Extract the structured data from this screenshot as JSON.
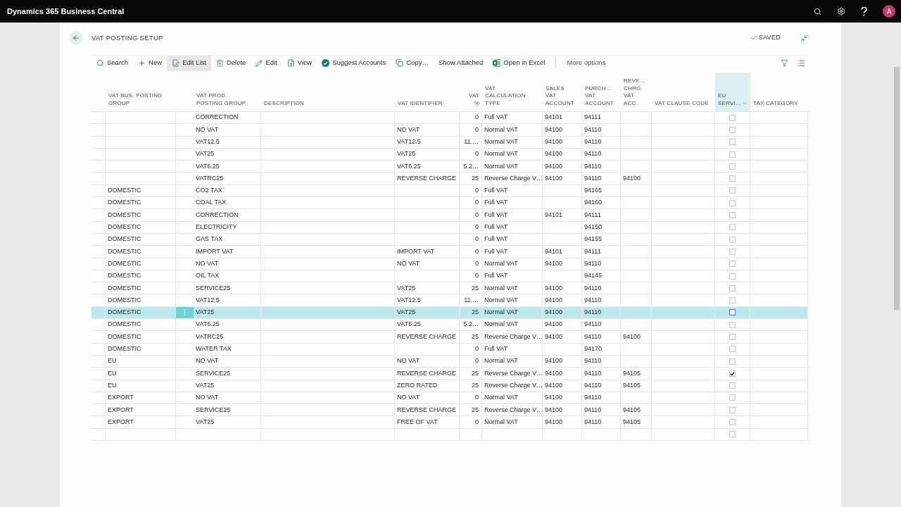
{
  "app_bar": {
    "title": "Dynamics 365 Business Central",
    "user_initial": "A"
  },
  "page": {
    "title": "VAT POSTING SETUP",
    "status": "SAVED"
  },
  "toolbar": {
    "actions": [
      {
        "label": "Search",
        "selected": false
      },
      {
        "label": "New",
        "selected": false
      },
      {
        "label": "Edit List",
        "selected": true
      },
      {
        "label": "Delete",
        "selected": false
      },
      {
        "label": "Edit",
        "selected": false
      },
      {
        "label": "View",
        "selected": false
      },
      {
        "label": "Suggest Accounts",
        "selected": false
      },
      {
        "label": "Copy…",
        "selected": false
      },
      {
        "label": "Show Attached",
        "selected": false
      },
      {
        "label": "Open in Excel",
        "selected": false
      }
    ],
    "more": "More options"
  },
  "table": {
    "columns": [
      {
        "label": "VAT BUS. POSTING\nGROUP",
        "kind": "text",
        "hovered": false
      },
      {
        "label": "VAT PROD.\nPOSTING GROUP",
        "kind": "text",
        "hovered": false
      },
      {
        "label": "DESCRIPTION",
        "kind": "text",
        "hovered": false
      },
      {
        "label": "VAT IDENTIFIER",
        "kind": "text",
        "hovered": false
      },
      {
        "label": "VAT\n%",
        "kind": "number",
        "hovered": false
      },
      {
        "label": "VAT\nCALCULATION\nTYPE",
        "kind": "text",
        "hovered": false
      },
      {
        "label": "SALES\nVAT\nACCOUNT",
        "kind": "text",
        "hovered": false
      },
      {
        "label": "PURCH…\nVAT\nACCOUNT",
        "kind": "text",
        "hovered": false
      },
      {
        "label": "REVE…\nCHRG.\nVAT\nACC.",
        "kind": "text",
        "hovered": false
      },
      {
        "label": "VAT CLAUSE CODE",
        "kind": "text",
        "hovered": false
      },
      {
        "label": "EU\nSERVI…",
        "kind": "checkbox",
        "hovered": true
      },
      {
        "label": "TAX CATEGORY",
        "kind": "text",
        "hovered": false
      }
    ],
    "rows": [
      {
        "prod": "CORRECTION",
        "vat_pct": "0",
        "calc_type": "Full VAT",
        "sales_acc": "94101",
        "purch_acc": "94111",
        "eu_service": false,
        "selected": false
      },
      {
        "prod": "NO VAT",
        "identifier": "NO VAT",
        "vat_pct": "0",
        "calc_type": "Normal VAT",
        "sales_acc": "94100",
        "purch_acc": "94110",
        "eu_service": false,
        "selected": false
      },
      {
        "prod": "VAT12.5",
        "identifier": "VAT12.5",
        "vat_pct": "11.…",
        "calc_type": "Normal VAT",
        "sales_acc": "94100",
        "purch_acc": "94110",
        "eu_service": false,
        "selected": false
      },
      {
        "prod": "VAT25",
        "identifier": "VAT25",
        "vat_pct": "0",
        "calc_type": "Normal VAT",
        "sales_acc": "94100",
        "purch_acc": "94110",
        "eu_service": false,
        "selected": false
      },
      {
        "prod": "VAT6.25",
        "identifier": "VAT6.25",
        "vat_pct": "5.2…",
        "calc_type": "Normal VAT",
        "sales_acc": "94100",
        "purch_acc": "94110",
        "eu_service": false,
        "selected": false
      },
      {
        "prod": "VATRC25",
        "identifier": "REVERSE CHARGE",
        "vat_pct": "25",
        "calc_type": "Reverse Charge V…",
        "sales_acc": "94100",
        "purch_acc": "94110",
        "rev_acc": "94100",
        "eu_service": false,
        "selected": false
      },
      {
        "bus": "DOMESTIC",
        "prod": "CO2 TAX",
        "vat_pct": "0",
        "calc_type": "Full VAT",
        "purch_acc": "94165",
        "eu_service": false,
        "selected": false
      },
      {
        "bus": "DOMESTIC",
        "prod": "COAL TAX",
        "vat_pct": "0",
        "calc_type": "Full VAT",
        "purch_acc": "94160",
        "eu_service": false,
        "selected": false
      },
      {
        "bus": "DOMESTIC",
        "prod": "CORRECTION",
        "vat_pct": "0",
        "calc_type": "Full VAT",
        "sales_acc": "94101",
        "purch_acc": "94111",
        "eu_service": false,
        "selected": false
      },
      {
        "bus": "DOMESTIC",
        "prod": "ELECTRICITY",
        "vat_pct": "0",
        "calc_type": "Full VAT",
        "purch_acc": "94150",
        "eu_service": false,
        "selected": false
      },
      {
        "bus": "DOMESTIC",
        "prod": "GAS TAX",
        "vat_pct": "0",
        "calc_type": "Full VAT",
        "purch_acc": "94155",
        "eu_service": false,
        "selected": false
      },
      {
        "bus": "DOMESTIC",
        "prod": "IMPORT VAT",
        "identifier": "IMPORT VAT",
        "vat_pct": "0",
        "calc_type": "Full VAT",
        "sales_acc": "94101",
        "purch_acc": "94111",
        "eu_service": false,
        "selected": false
      },
      {
        "bus": "DOMESTIC",
        "prod": "NO VAT",
        "identifier": "NO VAT",
        "vat_pct": "0",
        "calc_type": "Normal VAT",
        "sales_acc": "94100",
        "purch_acc": "94110",
        "eu_service": false,
        "selected": false
      },
      {
        "bus": "DOMESTIC",
        "prod": "OIL TAX",
        "vat_pct": "0",
        "calc_type": "Full VAT",
        "purch_acc": "94145",
        "eu_service": false,
        "selected": false
      },
      {
        "bus": "DOMESTIC",
        "prod": "SERVICE25",
        "identifier": "VAT25",
        "vat_pct": "25",
        "calc_type": "Normal VAT",
        "sales_acc": "94100",
        "purch_acc": "94110",
        "eu_service": false,
        "selected": false
      },
      {
        "bus": "DOMESTIC",
        "prod": "VAT12.5",
        "identifier": "VAT12.5",
        "vat_pct": "11.…",
        "calc_type": "Normal VAT",
        "sales_acc": "94100",
        "purch_acc": "94110",
        "eu_service": false,
        "selected": false
      },
      {
        "bus": "DOMESTIC",
        "prod": "VAT25",
        "identifier": "VAT25",
        "vat_pct": "25",
        "calc_type": "Normal VAT",
        "sales_acc": "94100",
        "purch_acc": "94110",
        "eu_service": false,
        "selected": true
      },
      {
        "bus": "DOMESTIC",
        "prod": "VAT6.25",
        "identifier": "VAT6.25",
        "vat_pct": "5.2…",
        "calc_type": "Normal VAT",
        "sales_acc": "94100",
        "purch_acc": "94110",
        "eu_service": false,
        "selected": false
      },
      {
        "bus": "DOMESTIC",
        "prod": "VATRC25",
        "identifier": "REVERSE CHARGE",
        "vat_pct": "25",
        "calc_type": "Reverse Charge V…",
        "sales_acc": "94100",
        "purch_acc": "94110",
        "rev_acc": "94100",
        "eu_service": false,
        "selected": false
      },
      {
        "bus": "DOMESTIC",
        "prod": "WATER TAX",
        "vat_pct": "0",
        "calc_type": "Full VAT",
        "purch_acc": "94170",
        "eu_service": false,
        "selected": false
      },
      {
        "bus": "EU",
        "prod": "NO VAT",
        "identifier": "NO VAT",
        "vat_pct": "0",
        "calc_type": "Normal VAT",
        "sales_acc": "94100",
        "purch_acc": "94110",
        "eu_service": false,
        "selected": false
      },
      {
        "bus": "EU",
        "prod": "SERVICE25",
        "identifier": "REVERSE CHARGE",
        "vat_pct": "25",
        "calc_type": "Reverse Charge V…",
        "sales_acc": "94100",
        "purch_acc": "94110",
        "rev_acc": "94105",
        "eu_service": true,
        "selected": false
      },
      {
        "bus": "EU",
        "prod": "VAT25",
        "identifier": "ZERO RATED",
        "vat_pct": "25",
        "calc_type": "Reverse Charge V…",
        "sales_acc": "94100",
        "purch_acc": "94110",
        "rev_acc": "94105",
        "eu_service": false,
        "selected": false
      },
      {
        "bus": "EXPORT",
        "prod": "NO VAT",
        "identifier": "NO VAT",
        "vat_pct": "0",
        "calc_type": "Normal VAT",
        "sales_acc": "94100",
        "purch_acc": "94110",
        "eu_service": false,
        "selected": false
      },
      {
        "bus": "EXPORT",
        "prod": "SERVICE25",
        "identifier": "REVERSE CHARGE",
        "vat_pct": "25",
        "calc_type": "Reverse Charge V…",
        "sales_acc": "94100",
        "purch_acc": "94110",
        "rev_acc": "94105",
        "eu_service": false,
        "selected": false
      },
      {
        "bus": "EXPORT",
        "prod": "VAT25",
        "identifier": "FREE OF VAT",
        "vat_pct": "0",
        "calc_type": "Normal VAT",
        "sales_acc": "94100",
        "purch_acc": "94110",
        "rev_acc": "94105",
        "eu_service": false,
        "selected": false
      },
      {
        "eu_service": false,
        "selected": false
      }
    ]
  }
}
